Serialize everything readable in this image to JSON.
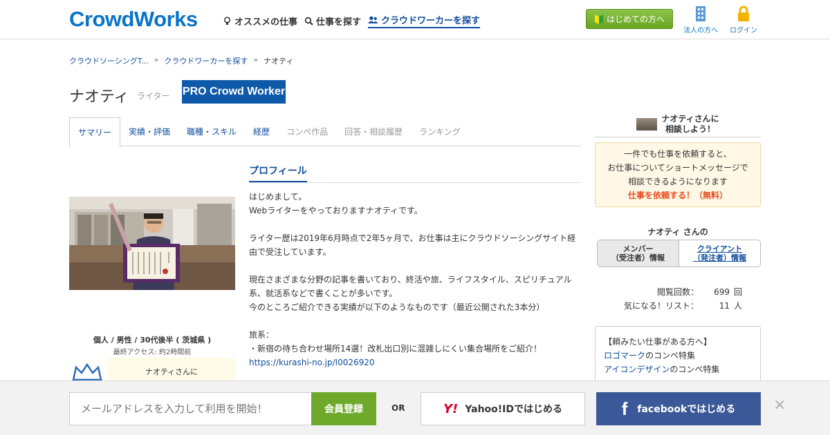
{
  "header": {
    "logo": "CrowdWorks",
    "nav": [
      {
        "label": "オススメの仕事",
        "icon": "bulb-icon"
      },
      {
        "label": "仕事を探す",
        "icon": "search-icon"
      },
      {
        "label": "クラウドワーカーを探す",
        "icon": "people-icon"
      }
    ],
    "first_time_button": "はじめての方へ",
    "corporate_link": "法人の方へ",
    "login_link": "ログイン"
  },
  "breadcrumb": [
    "クラウドソーシングT...",
    "クラウドワーカーを探す",
    "ナオティ"
  ],
  "profile_header": {
    "name": "ナオティ",
    "role": "ライター",
    "badge": "PRO Crowd Worker"
  },
  "tabs": [
    {
      "label": "サマリー",
      "state": "active"
    },
    {
      "label": "実績・評価",
      "state": "link"
    },
    {
      "label": "職種・スキル",
      "state": "link"
    },
    {
      "label": "経歴",
      "state": "link"
    },
    {
      "label": "コンペ作品",
      "state": "muted"
    },
    {
      "label": "回答・相談履歴",
      "state": "muted"
    },
    {
      "label": "ランキング",
      "state": "muted"
    }
  ],
  "left": {
    "demographics": "個人 / 男性 / 30代後半 ( 茨城県 )",
    "last_access": "最終アクセス: 約2時間前",
    "consult_mini": "ナオティさんに"
  },
  "profile": {
    "heading": "プロフィール",
    "lines": [
      "はじめまして。",
      "Webライターをやっておりますナオティです。",
      "",
      "ライター歴は2019年6月時点で2年5ヶ月で、お仕事は主にクラウドソーシングサイト経由で受注しています。",
      "",
      "現在さまざまな分野の記事を書いており、終活や旅、ライフスタイル、スピリチュアル系、就活系などで書くことが多いです。",
      "今のところご紹介できる実績が以下のようなものです（最近公開された3本分）",
      "",
      "旅系：",
      "・新宿の待ち合わせ場所14選！改札出口別に混雑しにくい集合場所をご紹介！"
    ],
    "link": "https://kurashi-no.jp/I0026920"
  },
  "sidebar": {
    "consult_line1": "ナオティさんに",
    "consult_line2": "相談しよう！",
    "note_lines": [
      "一件でも仕事を依頼すると、",
      "お仕事についてショートメッセージで",
      "相談できるようになります"
    ],
    "note_cta": "仕事を依頼する！（無料）",
    "owner": "ナオティ さんの",
    "toggle_on": "メンバー\n（受注者）情報",
    "toggle_off": "クライアント\n（発注者）情報",
    "stats": [
      {
        "label": "閲覧回数：",
        "value": "699",
        "unit": "回"
      },
      {
        "label": "気になる！リスト：",
        "value": "11",
        "unit": "人"
      }
    ],
    "box_title": "【頼みたい仕事がある方へ】",
    "box_items": [
      {
        "link": "ロゴマーク",
        "rest": "のコンペ特集"
      },
      {
        "link": "アイコンデザイン",
        "rest": "のコンペ特集"
      }
    ]
  },
  "bottom_bar": {
    "email_placeholder": "メールアドレスを入力して利用を開始！",
    "register_button": "会員登録",
    "or": "OR",
    "yahoo_logo": "Y!",
    "yahoo_button": "Yahoo!IDではじめる",
    "facebook_logo": "f",
    "facebook_button": "facebookではじめる",
    "close": "×"
  }
}
